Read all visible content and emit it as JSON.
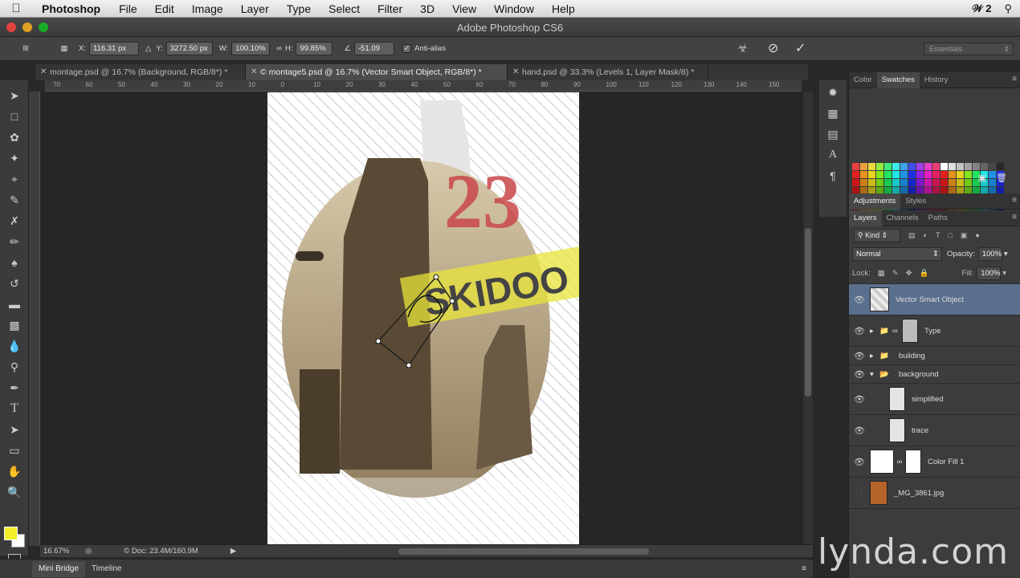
{
  "menubar": {
    "app": "Photoshop",
    "items": [
      "File",
      "Edit",
      "Image",
      "Layer",
      "Type",
      "Select",
      "Filter",
      "3D",
      "View",
      "Window",
      "Help"
    ],
    "right_adobe": "2"
  },
  "window": {
    "title": "Adobe Photoshop CS6"
  },
  "options": {
    "x_label": "X:",
    "x_value": "116.31 px",
    "y_label": "Y:",
    "y_value": "3272.50 px",
    "w_label": "W:",
    "w_value": "100.10%",
    "h_label": "H:",
    "h_value": "99.85%",
    "angle_value": "-51.09",
    "antialias_label": "Anti-alias",
    "workspace": "Essentials"
  },
  "tabs": [
    {
      "label": "montage.psd @ 16.7% (Background, RGB/8*) *"
    },
    {
      "label": "© montage5.psd @ 16.7% (Vector Smart Object, RGB/8*) *"
    },
    {
      "label": "hand.psd @ 33.3% (Levels 1, Layer Mask/8) *"
    }
  ],
  "ruler_ticks": [
    "70",
    "60",
    "50",
    "40",
    "30",
    "20",
    "10",
    "0",
    "10",
    "20",
    "30",
    "40",
    "50",
    "60",
    "70",
    "80",
    "90",
    "100",
    "110",
    "120",
    "130",
    "140",
    "150"
  ],
  "canvas": {
    "number": "23",
    "banner": "SKIDOO"
  },
  "status": {
    "zoom": "16.67%",
    "doc": "Doc: 23.4M/160.9M"
  },
  "bottom_tabs": [
    "Mini Bridge",
    "Timeline"
  ],
  "swatch_panel": {
    "tabs": [
      "Color",
      "Swatches",
      "History"
    ]
  },
  "adj_panel": {
    "tabs": [
      "Adjustments",
      "Styles"
    ]
  },
  "layers_panel": {
    "tabs": [
      "Layers",
      "Channels",
      "Paths"
    ],
    "kind": "Kind",
    "blend_mode": "Normal",
    "opacity_label": "Opacity:",
    "opacity": "100%",
    "lock_label": "Lock:",
    "fill_label": "Fill:",
    "fill": "100%",
    "layers": [
      {
        "name": "Vector Smart Object"
      },
      {
        "name": "Type"
      },
      {
        "name": "building"
      },
      {
        "name": "background"
      },
      {
        "name": "simplified"
      },
      {
        "name": "trace"
      },
      {
        "name": "Color Fill 1"
      },
      {
        "name": "_MG_3861.jpg"
      }
    ]
  },
  "watermark": "lynda.com"
}
